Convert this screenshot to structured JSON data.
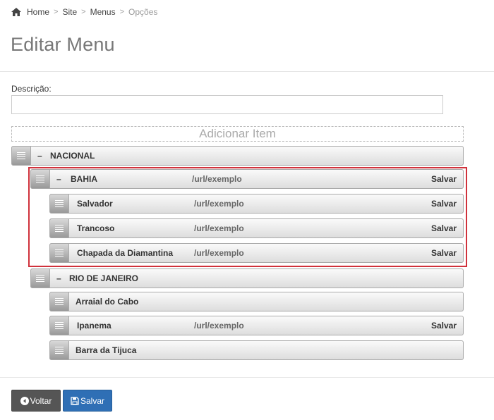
{
  "breadcrumb": {
    "home": "Home",
    "site": "Site",
    "menus": "Menus",
    "current": "Opções",
    "separator": ">"
  },
  "page": {
    "title": "Editar Menu"
  },
  "form": {
    "description_label": "Descrição:",
    "description_value": "",
    "add_item_label": "Adicionar Item"
  },
  "menu": {
    "nacional": {
      "toggle": "–",
      "label": "NACIONAL"
    },
    "bahia": {
      "toggle": "–",
      "label": "BAHIA",
      "url": "/url/exemplo",
      "save": "Salvar"
    },
    "salvador": {
      "label": "Salvador",
      "url": "/url/exemplo",
      "save": "Salvar"
    },
    "trancoso": {
      "label": "Trancoso",
      "url": "/url/exemplo",
      "save": "Salvar"
    },
    "chapada": {
      "label": "Chapada da Diamantina",
      "url": "/url/exemplo",
      "save": "Salvar"
    },
    "rio": {
      "toggle": "–",
      "label": "RIO DE JANEIRO"
    },
    "arraial": {
      "label": "Arraial do Cabo"
    },
    "ipanema": {
      "label": "Ipanema",
      "url": "/url/exemplo",
      "save": "Salvar"
    },
    "barra": {
      "label": "Barra da Tijuca"
    }
  },
  "buttons": {
    "back": "Voltar",
    "save": "Salvar"
  },
  "colors": {
    "highlight": "#d0313b",
    "primary": "#2f6fb5",
    "dark": "#555555"
  },
  "icons": {
    "home": "home-icon",
    "back": "arrow-left-circle-icon",
    "save": "floppy-disk-icon",
    "handle": "drag-handle-icon"
  }
}
